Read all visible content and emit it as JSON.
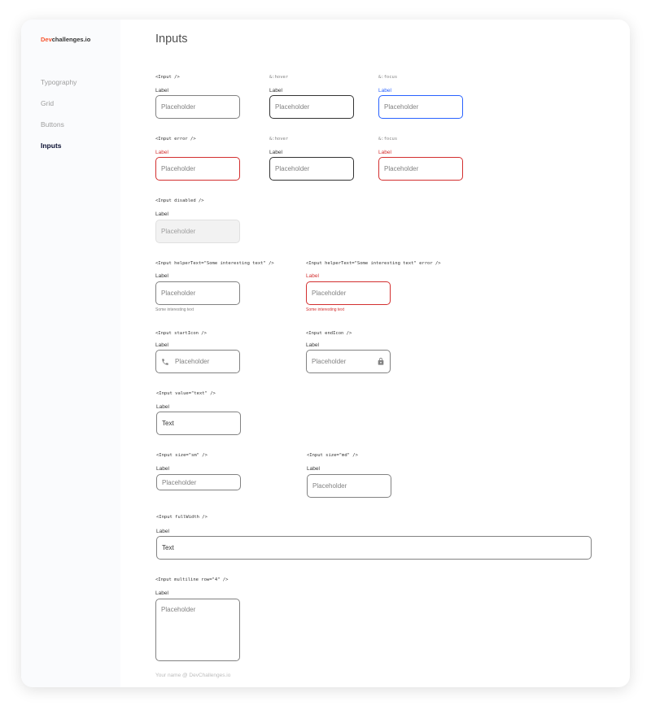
{
  "logo": {
    "brand": "Dev",
    "rest": "challenges.io"
  },
  "sidebar": {
    "items": [
      {
        "label": "Typography"
      },
      {
        "label": "Grid"
      },
      {
        "label": "Buttons"
      },
      {
        "label": "Inputs"
      }
    ]
  },
  "page": {
    "title": "Inputs"
  },
  "sections": {
    "default": {
      "code": "<Input />",
      "hover_code": "&:hover",
      "focus_code": "&:focus",
      "label": "Label",
      "placeholder": "Placeholder"
    },
    "error": {
      "code": "<Input error />",
      "hover_code": "&:hover",
      "focus_code": "&:focus",
      "label": "Label",
      "placeholder": "Placeholder"
    },
    "disabled": {
      "code": "<Input disabled />",
      "label": "Label",
      "placeholder": "Placeholder"
    },
    "helper": {
      "code": "<Input helperText=\"Some interesting text\" />",
      "label": "Label",
      "placeholder": "Placeholder",
      "helper": "Some interesting text"
    },
    "helper_error": {
      "code": "<Input helperText=\"Some interesting text\" error />",
      "label": "Label",
      "placeholder": "Placeholder",
      "helper": "Some interesting text"
    },
    "start_icon": {
      "code": "<Input startIcon />",
      "label": "Label",
      "placeholder": "Placeholder",
      "icon": "phone-icon"
    },
    "end_icon": {
      "code": "<Input endIcon />",
      "label": "Label",
      "placeholder": "Placeholder",
      "icon": "lock-icon"
    },
    "value": {
      "code": "<Input value=\"text\" />",
      "label": "Label",
      "value": "Text"
    },
    "size_sm": {
      "code": "<Input size=\"sm\" />",
      "label": "Label",
      "placeholder": "Placeholder"
    },
    "size_md": {
      "code": "<Input size=\"md\" />",
      "label": "Label",
      "placeholder": "Placeholder"
    },
    "full_width": {
      "code": "<Input fullWidth />",
      "label": "Label",
      "value": "Text"
    },
    "multiline": {
      "code": "<Input multiline row=\"4\" />",
      "label": "Label",
      "placeholder": "Placeholder"
    }
  },
  "footer": {
    "text": "Your name @ DevChallenges.io"
  },
  "colors": {
    "brand": "#F7542E",
    "active_nav": "#090F31",
    "error": "#D32F2F",
    "focus": "#2962FF",
    "border": "#828282",
    "border_hover": "#333333",
    "disabled_bg": "#F2F2F2"
  }
}
